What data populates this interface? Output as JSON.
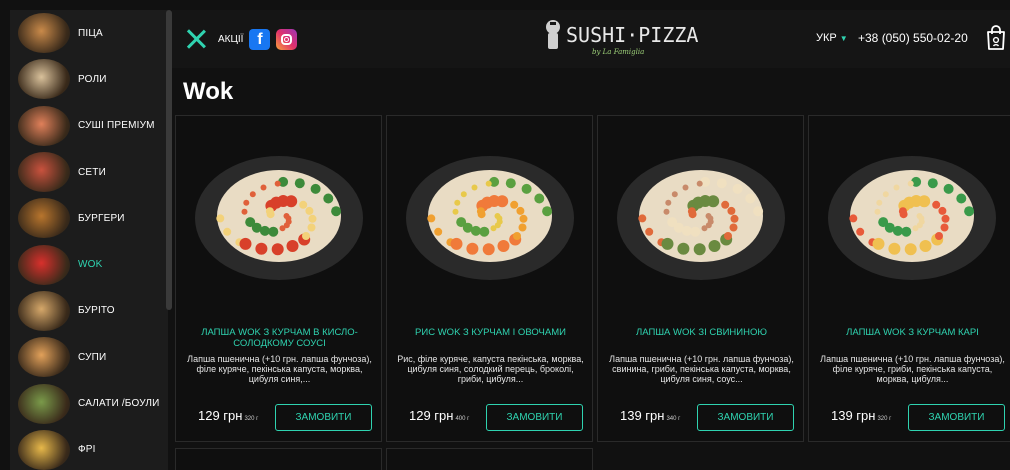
{
  "header": {
    "promo_label": "АКЦІЇ",
    "logo_text": "SUSHI·PIZZA",
    "logo_sub": "by La Famiglia",
    "language": "УКР",
    "phone": "+38 (050) 550-02-20"
  },
  "sidebar": {
    "items": [
      {
        "label": "ПІЦА",
        "icon": "pizza-icon",
        "color": "#c98a4a"
      },
      {
        "label": "РОЛИ",
        "icon": "rolls-icon",
        "color": "#d9c19b"
      },
      {
        "label": "СУШІ ПРЕМІУМ",
        "icon": "sushi-icon",
        "color": "#e0805a"
      },
      {
        "label": "СЕТИ",
        "icon": "sets-icon",
        "color": "#c9523e"
      },
      {
        "label": "БУРГЕРИ",
        "icon": "burger-icon",
        "color": "#b8752d"
      },
      {
        "label": "WOK",
        "icon": "wok-box-icon",
        "color": "#d8302c",
        "active": true
      },
      {
        "label": "БУРІТО",
        "icon": "burrito-icon",
        "color": "#d6a86a"
      },
      {
        "label": "СУПИ",
        "icon": "soup-icon",
        "color": "#e2a15a"
      },
      {
        "label": "САЛАТИ /БОУЛИ",
        "icon": "salad-icon",
        "color": "#7a9a4a"
      },
      {
        "label": "ФРІ",
        "icon": "fries-icon",
        "color": "#e7b84a"
      }
    ]
  },
  "page_title": "Wok",
  "products": [
    {
      "name": "ЛАПША WOK З КУРЧАМ В КИСЛО-СОЛОДКОМУ СОУСІ",
      "description": "Лапша пшенична (+10 грн. лапша фунчоза), філе куряче, пекінська капуста, морква, цибуля синя,...",
      "price": "129 грн",
      "weight": "320 г",
      "button": "ЗАМОВИТИ"
    },
    {
      "name": "РИС WOK З КУРЧАМ І ОВОЧАМИ",
      "description": "Рис, філе куряче, капуста пекінська, морква, цибуля синя, солодкий перець, броколі, гриби, цибуля...",
      "price": "129 грн",
      "weight": "400 г",
      "button": "ЗАМОВИТИ"
    },
    {
      "name": "ЛАПША WOK ЗІ СВИНИНОЮ",
      "description": "Лапша пшенична (+10 грн. лапша фунчоза), свинина, гриби, пекінська капуста, морква, цибуля синя, соус...",
      "price": "139 грн",
      "weight": "340 г",
      "button": "ЗАМОВИТИ"
    },
    {
      "name": "ЛАПША WOK З КУРЧАМ КАРІ",
      "description": "Лапша пшенична (+10 грн. лапша фунчоза), філе куряче, гриби, пекінська капуста, морква, цибуля...",
      "price": "139 грн",
      "weight": "320 г",
      "button": "ЗАМОВИТИ"
    }
  ],
  "colors": {
    "accent": "#2fd3b0",
    "background": "#111111",
    "sidebar": "#1c1c1c"
  }
}
